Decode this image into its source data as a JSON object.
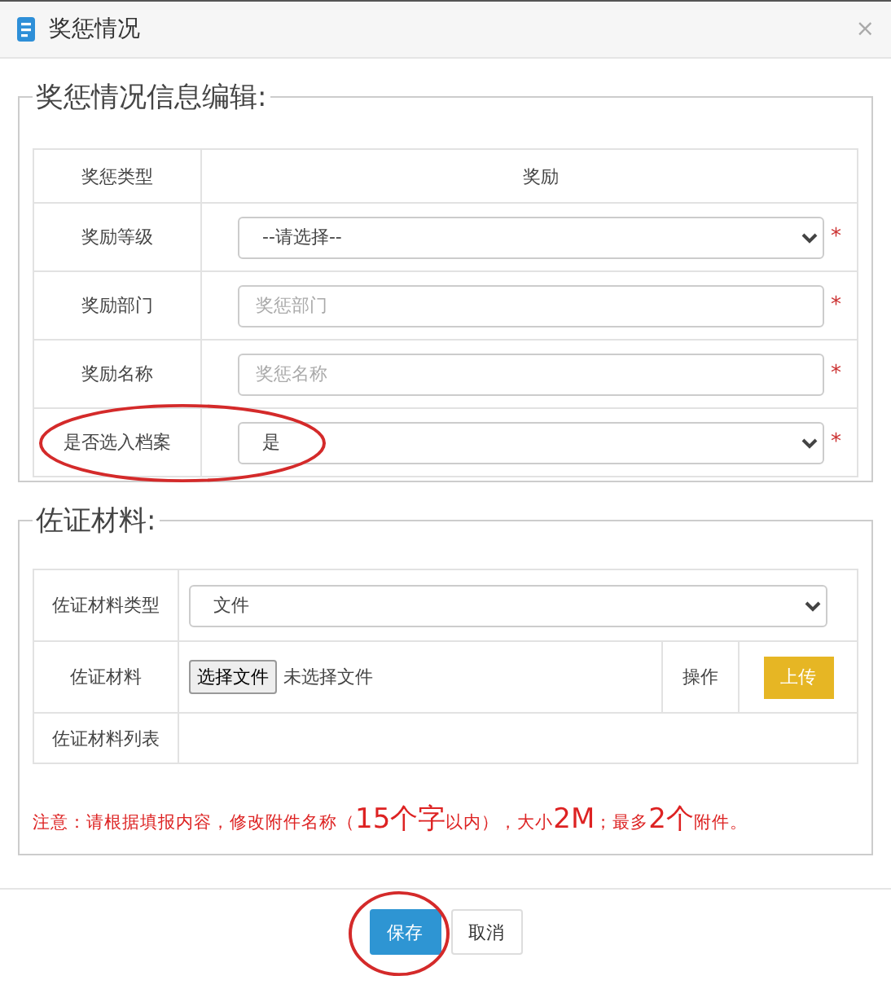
{
  "window": {
    "title": "奖惩情况",
    "close": "×"
  },
  "info_section": {
    "legend": "奖惩情况信息编辑:",
    "rows": [
      {
        "kind": "text",
        "label": "奖惩类型",
        "value": "奖励",
        "circled": false
      },
      {
        "kind": "select",
        "label": "奖励等级",
        "value": "--请选择--",
        "required_mark": "*",
        "circled": false
      },
      {
        "kind": "input",
        "label": "奖励部门",
        "placeholder": "奖惩部门",
        "required_mark": "*",
        "circled": false
      },
      {
        "kind": "input",
        "label": "奖励名称",
        "placeholder": "奖惩名称",
        "required_mark": "*",
        "circled": false
      },
      {
        "kind": "select",
        "label": "是否选入档案",
        "value": "是",
        "required_mark": "*",
        "circled": true
      }
    ]
  },
  "evidence_section": {
    "legend": "佐证材料:",
    "type_row": {
      "label": "佐证材料类型",
      "value": "文件"
    },
    "file_row": {
      "label": "佐证材料",
      "choose_button": "选择文件",
      "file_status": "未选择文件",
      "action_label": "操作",
      "upload_button": "上传"
    },
    "list_row": {
      "label": "佐证材料列表"
    },
    "note": [
      {
        "text": "注意：请根据填报内容，修改附件名称（",
        "large": false
      },
      {
        "text": "15个字",
        "large": true
      },
      {
        "text": "以内），大小",
        "large": false
      },
      {
        "text": "2M",
        "large": true
      },
      {
        "text": "；最多",
        "large": false
      },
      {
        "text": "2个",
        "large": true
      },
      {
        "text": "附件。",
        "large": false
      }
    ]
  },
  "buttons": [
    {
      "kind": "primary",
      "label": "保存",
      "circled": true
    },
    {
      "kind": "default",
      "label": "取消",
      "circled": false
    }
  ]
}
